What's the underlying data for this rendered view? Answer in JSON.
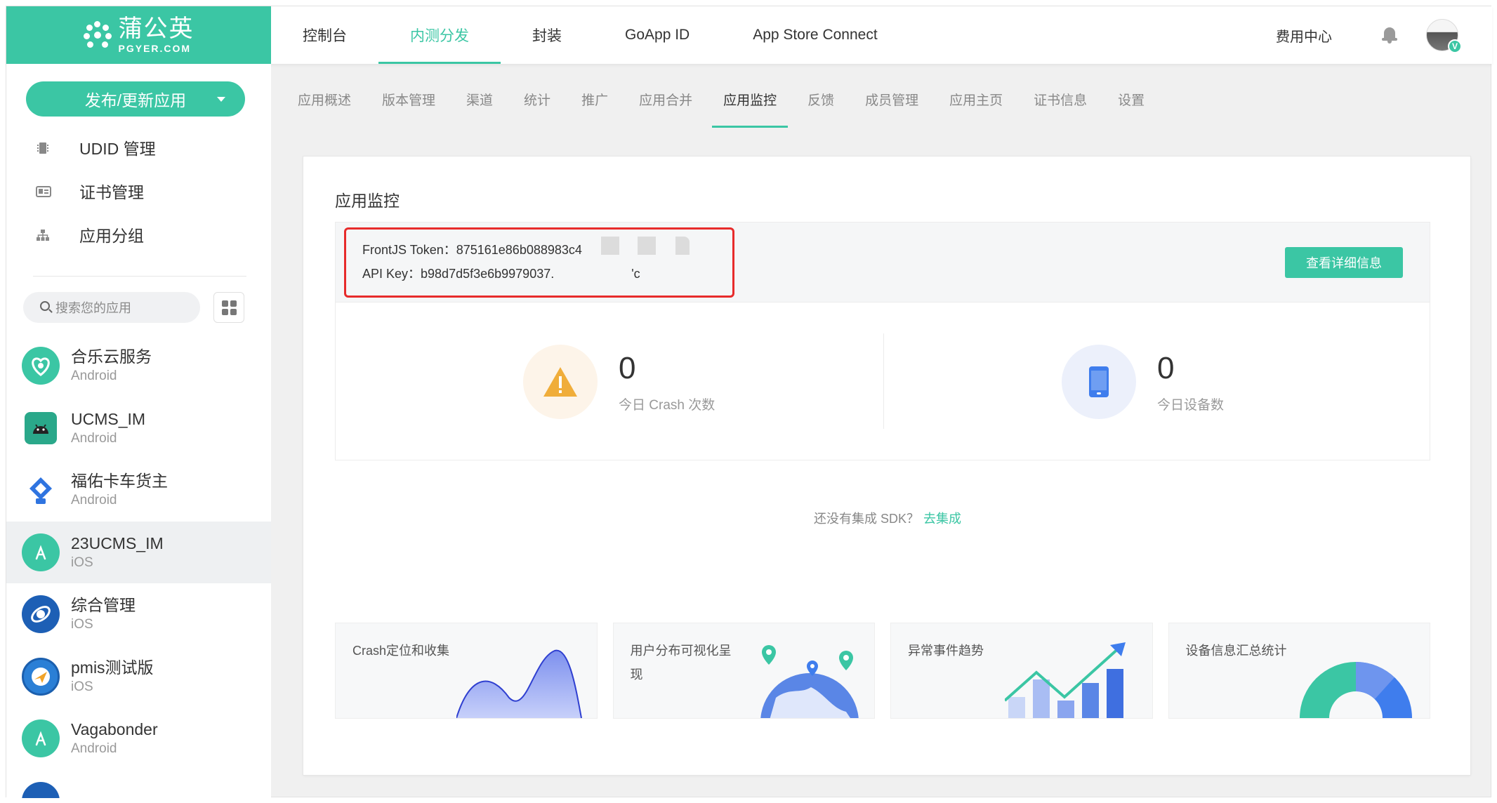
{
  "brand": {
    "cn": "蒲公英",
    "en": "PGYER.COM",
    "color": "#3bc6a4"
  },
  "topnav": [
    {
      "label": "控制台"
    },
    {
      "label": "内测分发",
      "active": true
    },
    {
      "label": "封装"
    },
    {
      "label": "GoApp ID"
    },
    {
      "label": "App Store Connect"
    }
  ],
  "topright": {
    "fee": "费用中心",
    "bell_icon": "bell-icon",
    "avatar_badge": "V"
  },
  "sidebar": {
    "publish_button": "发布/更新应用",
    "menu": [
      {
        "label": "UDID 管理",
        "icon": "chip-icon"
      },
      {
        "label": "证书管理",
        "icon": "id-card-icon"
      },
      {
        "label": "应用分组",
        "icon": "hierarchy-icon"
      }
    ],
    "search_placeholder": "搜索您的应用",
    "apps": [
      {
        "name": "合乐云服务",
        "platform": "Android",
        "color": "#3bc6a4"
      },
      {
        "name": "UCMS_IM",
        "platform": "Android",
        "color": "#2aa88a"
      },
      {
        "name": "福佑卡车货主",
        "platform": "Android",
        "color": "#2f74e0"
      },
      {
        "name": "23UCMS_IM",
        "platform": "iOS",
        "color": "#3bc6a4",
        "selected": true
      },
      {
        "name": "综合管理",
        "platform": "iOS",
        "color": "#1d5fb5"
      },
      {
        "name": "pmis测试版",
        "platform": "iOS",
        "color": "#2a7fd6"
      },
      {
        "name": "Vagabonder",
        "platform": "Android",
        "color": "#3bc6a4"
      }
    ]
  },
  "subnav": [
    {
      "label": "应用概述"
    },
    {
      "label": "版本管理"
    },
    {
      "label": "渠道"
    },
    {
      "label": "统计"
    },
    {
      "label": "推广"
    },
    {
      "label": "应用合并"
    },
    {
      "label": "应用监控",
      "active": true
    },
    {
      "label": "反馈"
    },
    {
      "label": "成员管理"
    },
    {
      "label": "应用主页"
    },
    {
      "label": "证书信息"
    },
    {
      "label": "设置"
    }
  ],
  "panel": {
    "title": "应用监控",
    "token_line": "FrontJS Token：875161e86b088983c4",
    "apikey_line": "API Key：b98d7d5f3e6b9979037.",
    "apikey_tail": "'c",
    "detail_button": "查看详细信息",
    "stats": [
      {
        "value": "0",
        "label": "今日 Crash 次数",
        "icon": "warning-icon"
      },
      {
        "value": "0",
        "label": "今日设备数",
        "icon": "phone-icon"
      }
    ],
    "sdk_text": "还没有集成 SDK？",
    "sdk_link": "去集成",
    "features": [
      {
        "title": "Crash定位和收集"
      },
      {
        "title": "用户分布可视化呈现"
      },
      {
        "title": "异常事件趋势"
      },
      {
        "title": "设备信息汇总统计"
      }
    ]
  }
}
